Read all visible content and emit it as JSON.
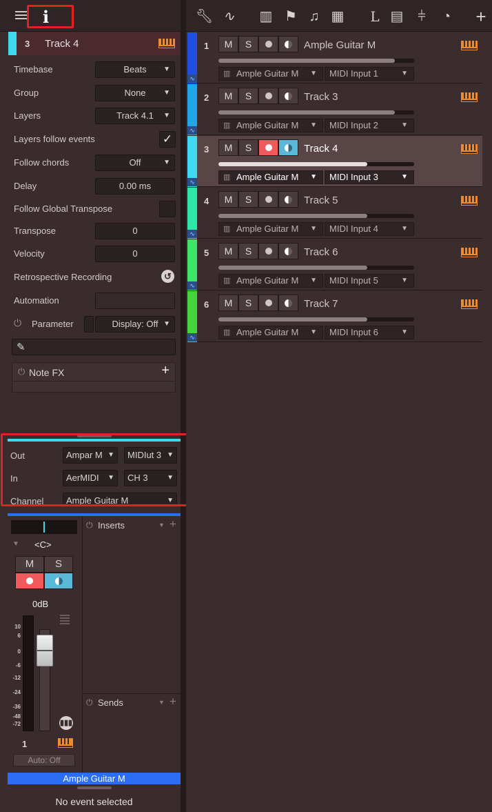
{
  "inspector": {
    "track_number": "3",
    "track_name": "Track 4",
    "rows": {
      "timebase_label": "Timebase",
      "timebase_value": "Beats",
      "group_label": "Group",
      "group_value": "None",
      "layers_label": "Layers",
      "layers_value": "Track 4.1",
      "layers_follow_label": "Layers follow events",
      "follow_chords_label": "Follow chords",
      "follow_chords_value": "Off",
      "delay_label": "Delay",
      "delay_value": "0.00 ms",
      "follow_transpose_label": "Follow Global Transpose",
      "transpose_label": "Transpose",
      "transpose_value": "0",
      "velocity_label": "Velocity",
      "velocity_value": "0",
      "retro_label": "Retrospective Recording",
      "automation_label": "Automation",
      "parameter_label": "Parameter",
      "display_value": "Display: Off"
    },
    "note_fx_label": "Note FX",
    "io": {
      "out_label": "Out",
      "out_value": "Ampar M",
      "out_midi": "MIDIut 3",
      "in_label": "In",
      "in_value": "AerMIDI",
      "in_channel": "CH 3",
      "channel_label": "Channel",
      "channel_value": "Ample Guitar M"
    },
    "channel_strip": {
      "pan": "<C>",
      "mute": "M",
      "solo": "S",
      "volume": "0dB",
      "scale": [
        "10",
        "6",
        "0",
        "-6",
        "-12",
        "-24",
        "-36",
        "-48",
        "-72"
      ],
      "channel_number": "1",
      "auto": "Auto: Off",
      "name": "Ample Guitar M",
      "inserts_label": "Inserts",
      "sends_label": "Sends"
    },
    "status": "No event selected"
  },
  "tracks": [
    {
      "num": "1",
      "name": "Ample Guitar M",
      "instrument": "Ample Guitar M",
      "midi": "MIDI Input 1",
      "color": "#1f4fe0",
      "fader": 0.9,
      "selected": false,
      "armed": false,
      "monitor": false
    },
    {
      "num": "2",
      "name": "Track 3",
      "instrument": "Ample Guitar M",
      "midi": "MIDI Input 2",
      "color": "#22a6e8",
      "fader": 0.9,
      "selected": false,
      "armed": false,
      "monitor": false
    },
    {
      "num": "3",
      "name": "Track 4",
      "instrument": "Ample Guitar M",
      "midi": "MIDI Input 3",
      "color": "#3fd8f0",
      "fader": 0.76,
      "selected": true,
      "armed": true,
      "monitor": true
    },
    {
      "num": "4",
      "name": "Track 5",
      "instrument": "Ample Guitar M",
      "midi": "MIDI Input 4",
      "color": "#2fe6a8",
      "fader": 0.76,
      "selected": false,
      "armed": false,
      "monitor": false
    },
    {
      "num": "5",
      "name": "Track 6",
      "instrument": "Ample Guitar M",
      "midi": "MIDI Input 5",
      "color": "#3ee36a",
      "fader": 0.76,
      "selected": false,
      "armed": false,
      "monitor": false
    },
    {
      "num": "6",
      "name": "Track 7",
      "instrument": "Ample Guitar M",
      "midi": "MIDI Input 6",
      "color": "#45d43e",
      "fader": 0.76,
      "selected": false,
      "armed": false,
      "monitor": false
    }
  ],
  "track_buttons": {
    "mute": "M",
    "solo": "S"
  },
  "colors": {
    "accent_cyan": "#3fd8f0",
    "record_red": "#f05a5a",
    "monitor_blue": "#5bb8d8",
    "piano_orange": "#f08a30",
    "highlight": "#e02222",
    "channel_blue": "#2b6ef5"
  }
}
